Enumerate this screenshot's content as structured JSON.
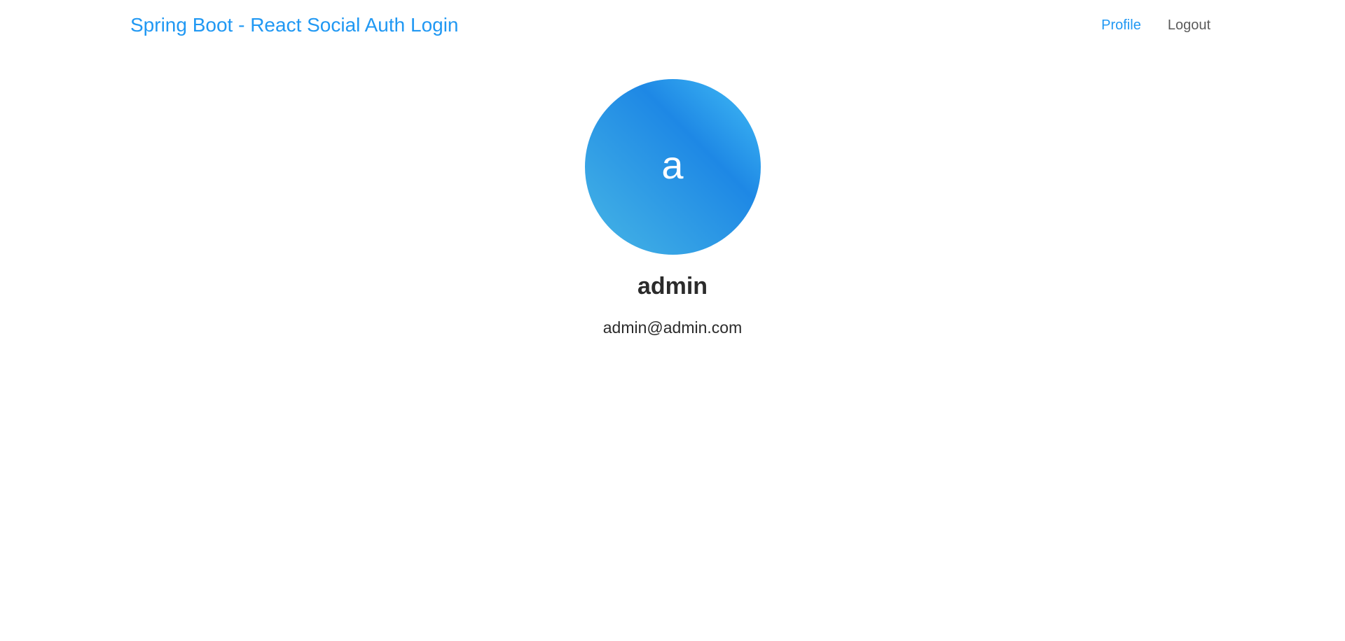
{
  "header": {
    "brand": "Spring Boot - React Social Auth Login",
    "nav": {
      "profile_label": "Profile",
      "logout_label": "Logout"
    }
  },
  "profile": {
    "avatar_initial": "a",
    "name": "admin",
    "email": "admin@admin.com"
  },
  "colors": {
    "accent": "#2098f3",
    "avatar_gradient_start": "#46b5e5",
    "avatar_gradient_mid": "#1e88e5",
    "avatar_gradient_end": "#40baf5",
    "text": "#2b2b2b"
  },
  "icons": {
    "avatar": "user-avatar-initial"
  }
}
